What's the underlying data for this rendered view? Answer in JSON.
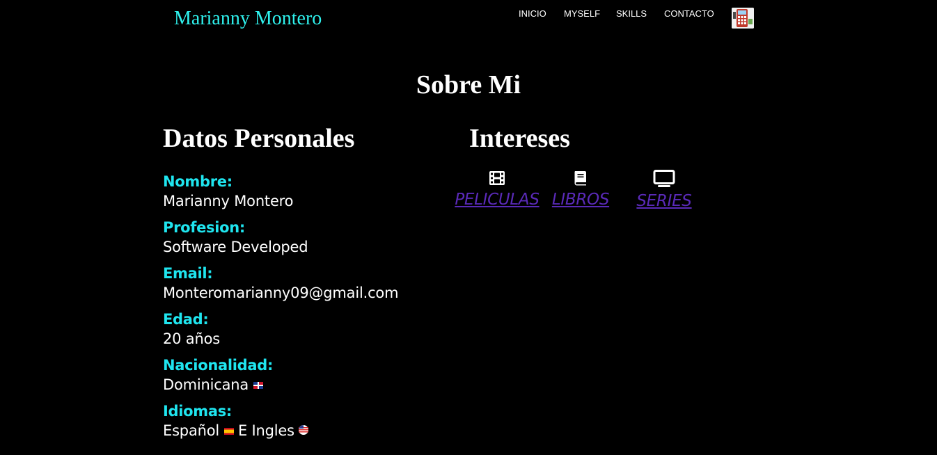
{
  "header": {
    "brand": "Marianny Montero",
    "nav": [
      "INICIO",
      "MYSELF",
      "SKILLS",
      "CONTACTO"
    ],
    "logo_icon": "calculator-icon"
  },
  "main": {
    "title": "Sobre Mi",
    "datos": {
      "heading": "Datos Personales",
      "items": [
        {
          "label": "Nombre:",
          "value": "Marianny Montero"
        },
        {
          "label": "Profesion:",
          "value": "Software Developed"
        },
        {
          "label": "Email:",
          "value": "Monteromarianny09@gmail.com"
        },
        {
          "label": "Edad:",
          "value": "20 años"
        },
        {
          "label": "Nacionalidad:",
          "value": "Dominicana"
        },
        {
          "label": "Idiomas:",
          "value": "Español",
          "value2": "E Ingles"
        }
      ]
    },
    "intereses": {
      "heading": "Intereses",
      "items": [
        {
          "icon": "film-icon",
          "label": "PELICULAS"
        },
        {
          "icon": "book-icon",
          "label": "LIBROS"
        },
        {
          "icon": "tv-icon",
          "label": "SERIES"
        }
      ]
    }
  },
  "colors": {
    "background": "#000000",
    "accent": "#2ff2ee",
    "link": "#5a2ab8"
  }
}
